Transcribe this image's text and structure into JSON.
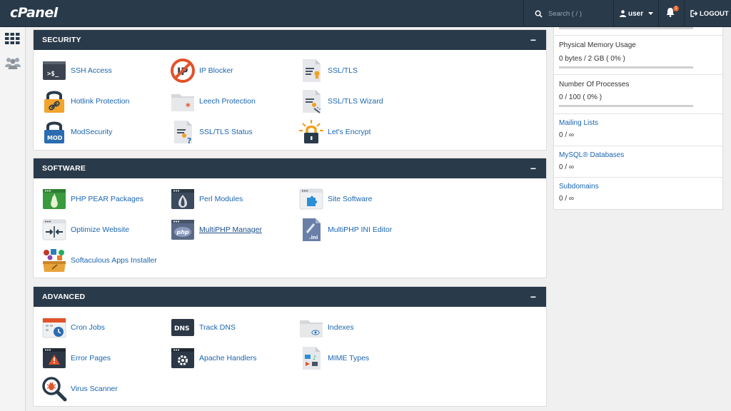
{
  "app": {
    "logo": "cPanel"
  },
  "header": {
    "search_placeholder": "Search ( / )",
    "user_label": "user",
    "notification_count": "1",
    "logout_label": "LOGOUT"
  },
  "sections": [
    {
      "title": "SECURITY",
      "collapse": "−",
      "items": [
        {
          "label": "SSH Access",
          "icon": "terminal-icon"
        },
        {
          "label": "IP Blocker",
          "icon": "ip-blocker-icon"
        },
        {
          "label": "SSL/TLS",
          "icon": "certificate-icon"
        },
        {
          "label": "Hotlink Protection",
          "icon": "padlock-link-icon"
        },
        {
          "label": "Leech Protection",
          "icon": "folder-asterisk-icon"
        },
        {
          "label": "SSL/TLS Wizard",
          "icon": "certificate-wand-icon"
        },
        {
          "label": "ModSecurity",
          "icon": "padlock-mod-icon"
        },
        {
          "label": "SSL/TLS Status",
          "icon": "certificate-question-icon"
        },
        {
          "label": "Let's Encrypt",
          "icon": "padlock-sunburst-icon"
        }
      ]
    },
    {
      "title": "SOFTWARE",
      "collapse": "−",
      "items": [
        {
          "label": "PHP PEAR Packages",
          "icon": "pear-window-icon"
        },
        {
          "label": "Perl Modules",
          "icon": "onion-window-icon"
        },
        {
          "label": "Site Software",
          "icon": "puzzle-window-icon"
        },
        {
          "label": "Optimize Website",
          "icon": "compress-window-icon"
        },
        {
          "label": "MultiPHP Manager",
          "icon": "php-window-icon"
        },
        {
          "label": "MultiPHP INI Editor",
          "icon": "ini-file-icon"
        },
        {
          "label": "Softaculous Apps Installer",
          "icon": "softaculous-box-icon"
        }
      ]
    },
    {
      "title": "ADVANCED",
      "collapse": "−",
      "items": [
        {
          "label": "Cron Jobs",
          "icon": "calendar-clock-icon"
        },
        {
          "label": "Track DNS",
          "icon": "dns-icon"
        },
        {
          "label": "Indexes",
          "icon": "folder-eye-icon"
        },
        {
          "label": "Error Pages",
          "icon": "warning-window-icon"
        },
        {
          "label": "Apache Handlers",
          "icon": "gear-window-icon"
        },
        {
          "label": "MIME Types",
          "icon": "mime-file-icon"
        },
        {
          "label": "Virus Scanner",
          "icon": "magnifier-bug-icon"
        }
      ]
    }
  ],
  "stats": [
    {
      "label": "Physical Memory Usage",
      "value": "0 bytes / 2 GB ( 0% )",
      "percent": 0,
      "link": false
    },
    {
      "label": "Number Of Processes",
      "value": "0 / 100 ( 0% )",
      "percent": 0,
      "link": false
    },
    {
      "label": "Mailing Lists",
      "value": "0 / ∞",
      "link": true
    },
    {
      "label": "MySQL® Databases",
      "value": "0 / ∞",
      "link": true
    },
    {
      "label": "Subdomains",
      "value": "0 / ∞",
      "link": true
    }
  ],
  "colors": {
    "header_bg": "#293a4a",
    "link_blue": "#1a65b0",
    "badge_orange": "#e3632d",
    "bar_fill": "#4a8bd1"
  }
}
